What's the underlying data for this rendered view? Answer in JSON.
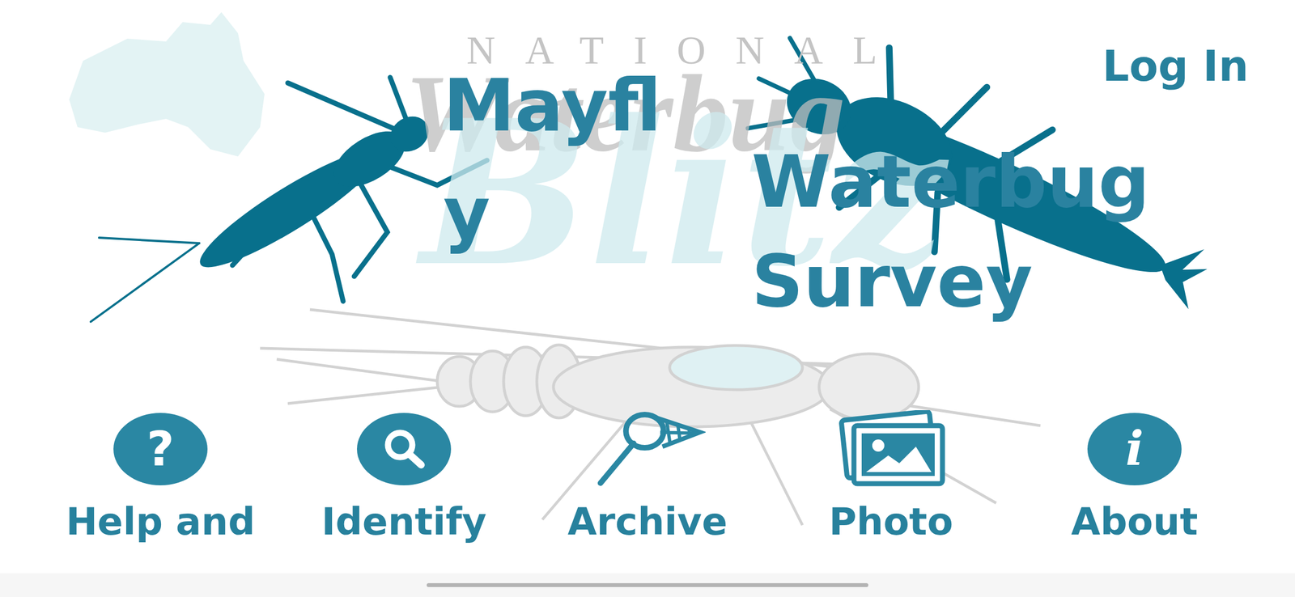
{
  "header": {
    "login": "Log In"
  },
  "logo": {
    "top": "NATIONAL",
    "script": "Waterbug",
    "watermark": "Blitz"
  },
  "title": {
    "lead": "Mayfly",
    "main": "Waterbug Survey"
  },
  "nav": [
    {
      "label": "Help and",
      "kind": "glyph",
      "glyph": "?"
    },
    {
      "label": "Identify",
      "kind": "search"
    },
    {
      "label": "Archive",
      "kind": "net"
    },
    {
      "label": "Photo",
      "kind": "photos"
    },
    {
      "label": "About",
      "kind": "glyph",
      "glyph": "i"
    }
  ]
}
